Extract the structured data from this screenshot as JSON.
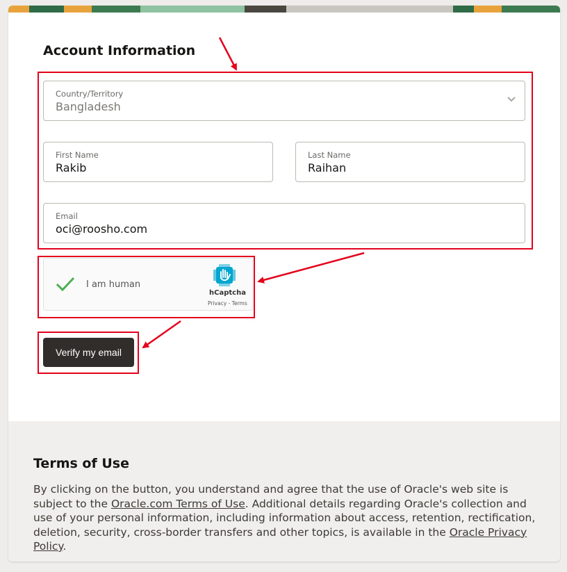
{
  "section": {
    "title": "Account Information"
  },
  "form": {
    "country": {
      "label": "Country/Territory",
      "value": "Bangladesh"
    },
    "first_name": {
      "label": "First Name",
      "value": "Rakib"
    },
    "last_name": {
      "label": "Last Name",
      "value": "Raihan"
    },
    "email": {
      "label": "Email",
      "value": "oci@roosho.com"
    }
  },
  "captcha": {
    "label": "I am human",
    "brand": "hCaptcha",
    "privacy": "Privacy",
    "separator": " - ",
    "terms": "Terms",
    "checked": true
  },
  "verify_button": {
    "label": "Verify my email"
  },
  "terms": {
    "title": "Terms of Use",
    "text_1": "By clicking on the button, you understand and agree that the use of Oracle's web site is subject to the ",
    "link_1": "Oracle.com Terms of Use",
    "text_2": ". Additional details regarding Oracle's collection and use of your personal information, including information about access, retention, rectification, deletion, security, cross-border transfers and other topics, is available in the ",
    "link_2": "Oracle Privacy Policy",
    "text_3": "."
  },
  "colors": {
    "annotation_red": "#e4001b",
    "button_bg": "#312d2a",
    "check_green": "#4caf50",
    "captcha_blue": "#00a6cf"
  },
  "icons": {
    "dropdown": "chevron-down-icon",
    "captcha_check": "checkmark-icon",
    "captcha_logo": "hcaptcha-logo-icon"
  }
}
